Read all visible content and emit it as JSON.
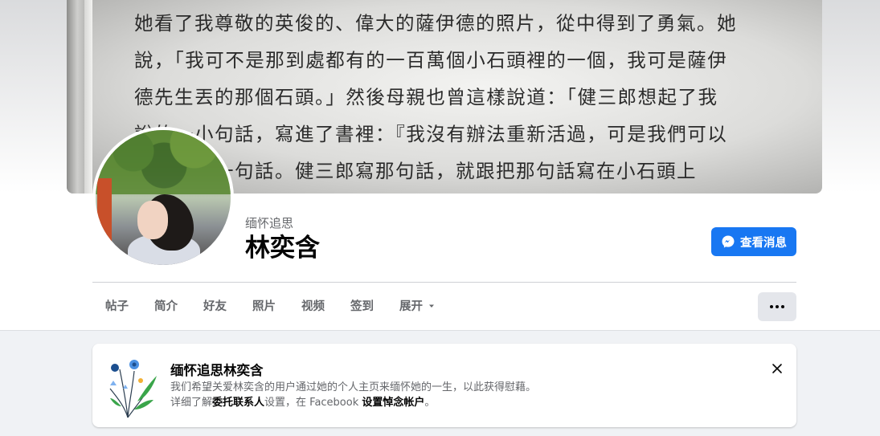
{
  "cover": {
    "lines": [
      "她看了我尊敬的英俊的、偉大的薩伊德的照片，從中得到了勇氣。她",
      "說，「我可不是那到處都有的一百萬個小石頭裡的一個，我可是薩伊",
      "德先生丟的那個石頭。」然後母親也曾這樣說道：「健三郎想起了我",
      "說的一小句話，寫進了書裡：『我沒有辦法重新活過，可是我們可以",
      "　　　這一句話。健三郎寫那句話，就跟把那句話寫在小石頭上"
    ]
  },
  "profile": {
    "memorial_label": "缅怀追思",
    "name": "林奕含"
  },
  "actions": {
    "message_label": "查看消息"
  },
  "tabs": [
    {
      "label": "帖子"
    },
    {
      "label": "简介"
    },
    {
      "label": "好友"
    },
    {
      "label": "照片"
    },
    {
      "label": "视频"
    },
    {
      "label": "签到"
    },
    {
      "label": "展开"
    }
  ],
  "memorial_card": {
    "title": "缅怀追思林奕含",
    "description": "我们希望关爱林奕含的用户通过她的个人主页来缅怀她的一生，以此获得慰藉。",
    "learn_prefix": "详细了解",
    "legacy_contact": "委托联系人",
    "mid_text": "设置，在 Facebook ",
    "memorial_settings": "设置悼念帐户",
    "end_text": "。"
  },
  "colors": {
    "accent": "#1877f2",
    "background": "#f0f2f5",
    "secondary_text": "#65676b"
  }
}
